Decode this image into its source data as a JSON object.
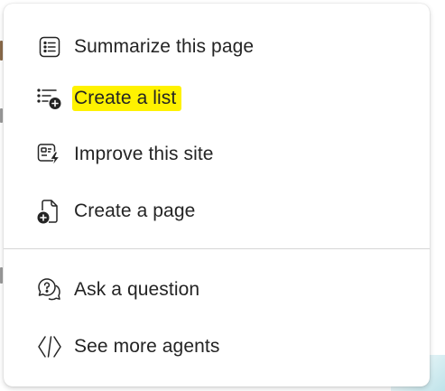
{
  "menu": {
    "items": [
      {
        "label": "Summarize this page",
        "icon": "summary-list-icon"
      },
      {
        "label": "Create a list",
        "icon": "create-list-icon",
        "highlighted": true,
        "highlight_color": "#fff200"
      },
      {
        "label": "Improve this site",
        "icon": "improve-site-icon"
      },
      {
        "label": "Create a page",
        "icon": "create-page-icon"
      },
      {
        "label": "Ask a question",
        "icon": "ask-question-icon"
      },
      {
        "label": "See more agents",
        "icon": "agents-icon"
      }
    ]
  },
  "colors": {
    "text": "#242424",
    "divider": "#d6d6d6",
    "highlight": "#fff200"
  }
}
